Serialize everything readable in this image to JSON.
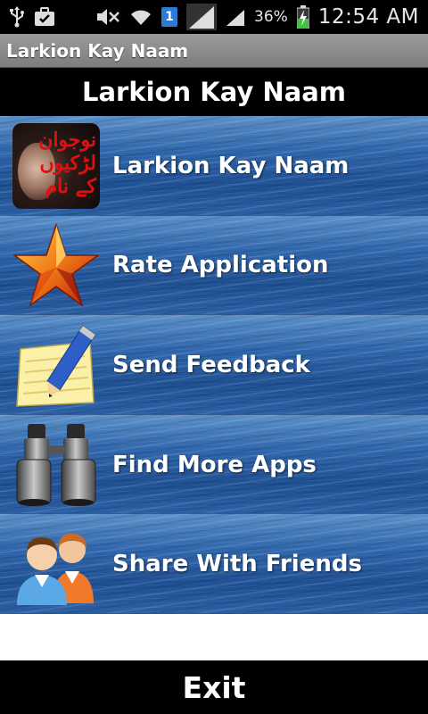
{
  "status_bar": {
    "sim_slot": "1",
    "battery_percent": "36%",
    "time": "12:54 AM",
    "icons": [
      "usb-icon",
      "briefcase-icon",
      "mute-icon",
      "wifi-icon",
      "sim-icon",
      "signal-icon",
      "signal-icon",
      "battery-charging-icon"
    ]
  },
  "app": {
    "title": "Larkion Kay Naam"
  },
  "header": {
    "title": "Larkion Kay Naam"
  },
  "menu": {
    "items": [
      {
        "label": "Larkion Kay Naam",
        "icon": "app-logo-icon",
        "logo_text": "نوجوان لڑکیوں کے نام"
      },
      {
        "label": "Rate Application",
        "icon": "star-icon"
      },
      {
        "label": "Send Feedback",
        "icon": "notepad-pencil-icon"
      },
      {
        "label": "Find More Apps",
        "icon": "binoculars-icon"
      },
      {
        "label": "Share With Friends",
        "icon": "people-icon"
      }
    ]
  },
  "footer": {
    "exit_label": "Exit"
  },
  "colors": {
    "bar_background": "#000000",
    "title_bar": "#8a8a8a",
    "menu_water": "#2f66ab",
    "sim_badge": "#2e7bd6",
    "battery_charge": "#3ec43e"
  }
}
